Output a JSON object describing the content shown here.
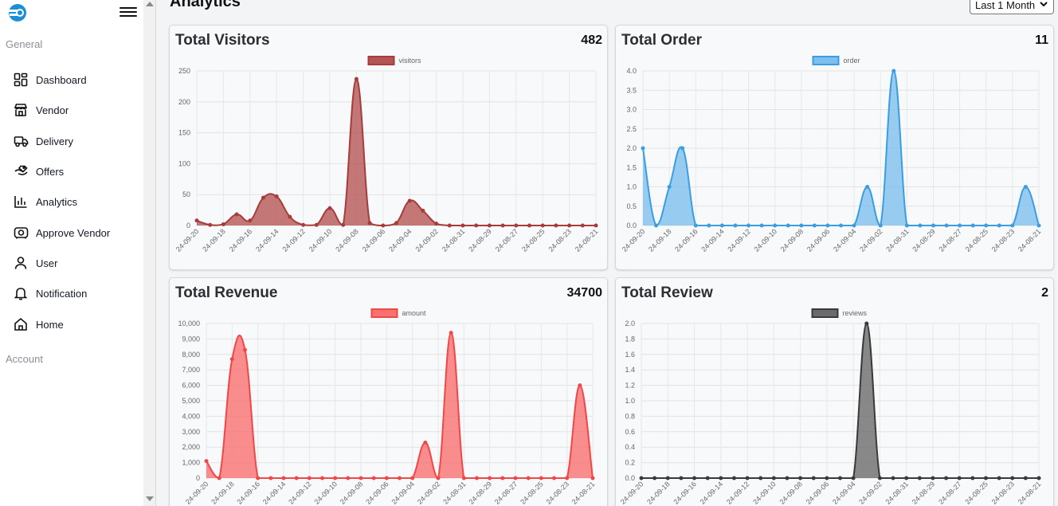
{
  "sidebar": {
    "general_label": "General",
    "account_label": "Account",
    "items": [
      {
        "label": "Dashboard",
        "icon": "dashboard-icon"
      },
      {
        "label": "Vendor",
        "icon": "store-icon"
      },
      {
        "label": "Delivery",
        "icon": "truck-icon"
      },
      {
        "label": "Offers",
        "icon": "offer-tag-icon"
      },
      {
        "label": "Analytics",
        "icon": "bar-chart-icon"
      },
      {
        "label": "Approve Vendor",
        "icon": "approve-vendor-icon"
      },
      {
        "label": "User",
        "icon": "user-icon"
      },
      {
        "label": "Notification",
        "icon": "bell-icon"
      },
      {
        "label": "Home",
        "icon": "home-icon"
      }
    ]
  },
  "header": {
    "title": "Analytics",
    "range_selected": "Last 1 Month"
  },
  "chart_data": [
    {
      "type": "area",
      "title": "Total Visitors",
      "total": "482",
      "x": [
        "24-09-20",
        "24-09-19",
        "24-09-18",
        "24-09-17",
        "24-09-16",
        "24-09-15",
        "24-09-14",
        "24-09-13",
        "24-09-12",
        "24-09-11",
        "24-09-10",
        "24-09-09",
        "24-09-08",
        "24-09-07",
        "24-09-06",
        "24-09-05",
        "24-09-04",
        "24-09-03",
        "24-09-02",
        "24-09-01",
        "24-08-31",
        "24-08-30",
        "24-08-29",
        "24-08-28",
        "24-08-27",
        "24-08-26",
        "24-08-25",
        "24-08-24",
        "24-08-23",
        "24-08-22",
        "24-08-21"
      ],
      "tick_labels": [
        "24-09-20",
        "24-09-18",
        "24-09-16",
        "24-09-14",
        "24-09-12",
        "24-09-10",
        "24-09-08",
        "24-09-06",
        "24-09-04",
        "24-09-02",
        "24-08-31",
        "24-08-29",
        "24-08-27",
        "24-08-25",
        "24-08-23",
        "24-08-21"
      ],
      "series": [
        {
          "name": "visitors",
          "values": [
            8,
            1,
            2,
            18,
            8,
            45,
            47,
            14,
            1,
            1,
            28,
            1,
            237,
            4,
            0,
            4,
            40,
            24,
            3,
            0,
            0,
            0,
            0,
            0,
            0,
            0,
            0,
            0,
            0,
            0,
            0
          ]
        }
      ],
      "ylim": [
        0,
        250
      ],
      "yticks": [
        0,
        50,
        100,
        150,
        200,
        250
      ],
      "grid": true,
      "legend": "top-center",
      "colors": {
        "line": "#a83b3b",
        "fill": "#b55656"
      }
    },
    {
      "type": "area",
      "title": "Total Order",
      "total": "11",
      "x": [
        "24-09-20",
        "24-09-19",
        "24-09-18",
        "24-09-17",
        "24-09-16",
        "24-09-15",
        "24-09-14",
        "24-09-13",
        "24-09-12",
        "24-09-11",
        "24-09-10",
        "24-09-09",
        "24-09-08",
        "24-09-07",
        "24-09-06",
        "24-09-05",
        "24-09-04",
        "24-09-03",
        "24-09-02",
        "24-09-01",
        "24-08-31",
        "24-08-30",
        "24-08-29",
        "24-08-28",
        "24-08-27",
        "24-08-26",
        "24-08-25",
        "24-08-24",
        "24-08-23",
        "24-08-22",
        "24-08-21"
      ],
      "tick_labels": [
        "24-09-20",
        "24-09-18",
        "24-09-16",
        "24-09-14",
        "24-09-12",
        "24-09-10",
        "24-09-08",
        "24-09-06",
        "24-09-04",
        "24-09-02",
        "24-08-31",
        "24-08-29",
        "24-08-27",
        "24-08-25",
        "24-08-23",
        "24-08-21"
      ],
      "series": [
        {
          "name": "order",
          "values": [
            2,
            0,
            1,
            2,
            0,
            0,
            0,
            0,
            0,
            0,
            0,
            0,
            0,
            0,
            0,
            0,
            0,
            1,
            0,
            4,
            0,
            0,
            0,
            0,
            0,
            0,
            0,
            0,
            0,
            1,
            0
          ]
        }
      ],
      "ylim": [
        0,
        4
      ],
      "yticks": [
        0,
        0.5,
        1.0,
        1.5,
        2.0,
        2.5,
        3.0,
        3.5,
        4.0
      ],
      "grid": true,
      "legend": "top-center",
      "colors": {
        "line": "#3a9ee0",
        "fill": "#7fbfee"
      }
    },
    {
      "type": "area",
      "title": "Total Revenue",
      "total": "34700",
      "x": [
        "24-09-20",
        "24-09-19",
        "24-09-18",
        "24-09-17",
        "24-09-16",
        "24-09-15",
        "24-09-14",
        "24-09-13",
        "24-09-12",
        "24-09-11",
        "24-09-10",
        "24-09-09",
        "24-09-08",
        "24-09-07",
        "24-09-06",
        "24-09-05",
        "24-09-04",
        "24-09-03",
        "24-09-02",
        "24-09-01",
        "24-08-31",
        "24-08-30",
        "24-08-29",
        "24-08-28",
        "24-08-27",
        "24-08-26",
        "24-08-25",
        "24-08-24",
        "24-08-23",
        "24-08-22",
        "24-08-21"
      ],
      "tick_labels": [
        "24-09-20",
        "24-09-18",
        "24-09-16",
        "24-09-14",
        "24-09-12",
        "24-09-10",
        "24-09-08",
        "24-09-06",
        "24-09-04",
        "24-09-02",
        "24-08-31",
        "24-08-29",
        "24-08-27",
        "24-08-25",
        "24-08-23",
        "24-08-21"
      ],
      "series": [
        {
          "name": "amount",
          "values": [
            1100,
            0,
            7700,
            8300,
            0,
            0,
            0,
            0,
            0,
            0,
            0,
            0,
            0,
            0,
            0,
            0,
            0,
            2300,
            0,
            9400,
            0,
            0,
            0,
            0,
            0,
            0,
            0,
            0,
            0,
            6000,
            0
          ]
        }
      ],
      "ylim": [
        0,
        10000
      ],
      "yticks": [
        0,
        1000,
        2000,
        3000,
        4000,
        5000,
        6000,
        7000,
        8000,
        9000,
        10000
      ],
      "grid": true,
      "legend": "top-center",
      "colors": {
        "line": "#f04848",
        "fill": "#f97070"
      }
    },
    {
      "type": "area",
      "title": "Total Review",
      "total": "2",
      "x": [
        "24-09-20",
        "24-09-19",
        "24-09-18",
        "24-09-17",
        "24-09-16",
        "24-09-15",
        "24-09-14",
        "24-09-13",
        "24-09-12",
        "24-09-11",
        "24-09-10",
        "24-09-09",
        "24-09-08",
        "24-09-07",
        "24-09-06",
        "24-09-05",
        "24-09-04",
        "24-09-03",
        "24-09-02",
        "24-09-01",
        "24-08-31",
        "24-08-30",
        "24-08-29",
        "24-08-28",
        "24-08-27",
        "24-08-26",
        "24-08-25",
        "24-08-24",
        "24-08-23",
        "24-08-22",
        "24-08-21"
      ],
      "tick_labels": [
        "24-09-20",
        "24-09-18",
        "24-09-16",
        "24-09-14",
        "24-09-12",
        "24-09-10",
        "24-09-08",
        "24-09-06",
        "24-09-04",
        "24-09-02",
        "24-08-31",
        "24-08-29",
        "24-08-27",
        "24-08-25",
        "24-08-23",
        "24-08-21"
      ],
      "series": [
        {
          "name": "reviews",
          "values": [
            0,
            0,
            0,
            0,
            0,
            0,
            0,
            0,
            0,
            0,
            0,
            0,
            0,
            0,
            0,
            0,
            0,
            2,
            0,
            0,
            0,
            0,
            0,
            0,
            0,
            0,
            0,
            0,
            0,
            0,
            0
          ]
        }
      ],
      "ylim": [
        0,
        2
      ],
      "yticks": [
        0,
        0.2,
        0.4,
        0.6,
        0.8,
        1.0,
        1.2,
        1.4,
        1.6,
        1.8,
        2.0
      ],
      "grid": true,
      "legend": "top-center",
      "colors": {
        "line": "#3a3a3a",
        "fill": "#6b6b6b"
      }
    }
  ]
}
